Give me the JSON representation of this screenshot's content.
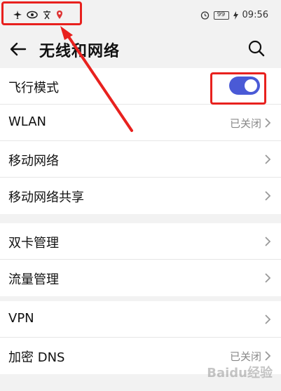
{
  "status_bar": {
    "left_icons": [
      "airplane-icon",
      "eye-icon",
      "language-icon",
      "location-pin-icon"
    ],
    "battery": "99",
    "time": "09:56"
  },
  "header": {
    "title": "无线和网络"
  },
  "group1": {
    "items": [
      {
        "label": "飞行模式",
        "toggle_on": true
      },
      {
        "label": "WLAN",
        "value": "已关闭"
      },
      {
        "label": "移动网络"
      },
      {
        "label": "移动网络共享"
      }
    ]
  },
  "group2": {
    "items": [
      {
        "label": "双卡管理"
      },
      {
        "label": "流量管理"
      }
    ]
  },
  "group3": {
    "items": [
      {
        "label": "VPN"
      },
      {
        "label": "加密 DNS",
        "value": "已关闭"
      }
    ]
  },
  "watermark": "Baidu经验",
  "colors": {
    "accent": "#4a5ad6",
    "annotation": "#e8211e"
  }
}
